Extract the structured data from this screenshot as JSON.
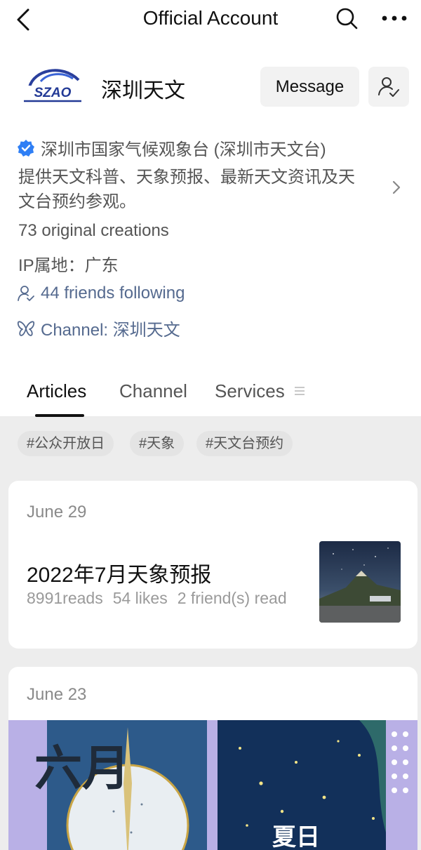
{
  "header": {
    "title": "Official Account",
    "back_icon": "chevron-left-icon",
    "search_icon": "search-icon",
    "more_icon": "more-dots-icon"
  },
  "profile": {
    "logo_text": "SZAO",
    "name": "深圳天文",
    "message_label": "Message",
    "follow_icon": "person-check-icon",
    "verified_text": "深圳市国家气候观象台 (深圳市天文台)",
    "description_line1": "提供天文科普、天象预报、最新天文资讯及天",
    "description_line2": "文台预约参观。",
    "original_creations": "73 original creations",
    "ip_location": "IP属地：广东",
    "friends_following": "44 friends following",
    "channel": "Channel: 深圳天文"
  },
  "tabs": [
    {
      "label": "Articles",
      "active": true
    },
    {
      "label": "Channel",
      "active": false
    },
    {
      "label": "Services",
      "active": false
    }
  ],
  "tags": [
    "#公众开放日",
    "#天象",
    "#天文台预约"
  ],
  "articles": [
    {
      "date": "June 29",
      "title": "2022年7月天象预报",
      "reads": "8991reads",
      "likes": "54 likes",
      "friends": "2 friend(s) read"
    },
    {
      "date": "June 23",
      "banner_left_text": "六月",
      "banner_right_text": "夏日"
    }
  ],
  "colors": {
    "link": "#556a8f",
    "verified": "#2f7ff5",
    "feed_bg": "#ededed"
  }
}
